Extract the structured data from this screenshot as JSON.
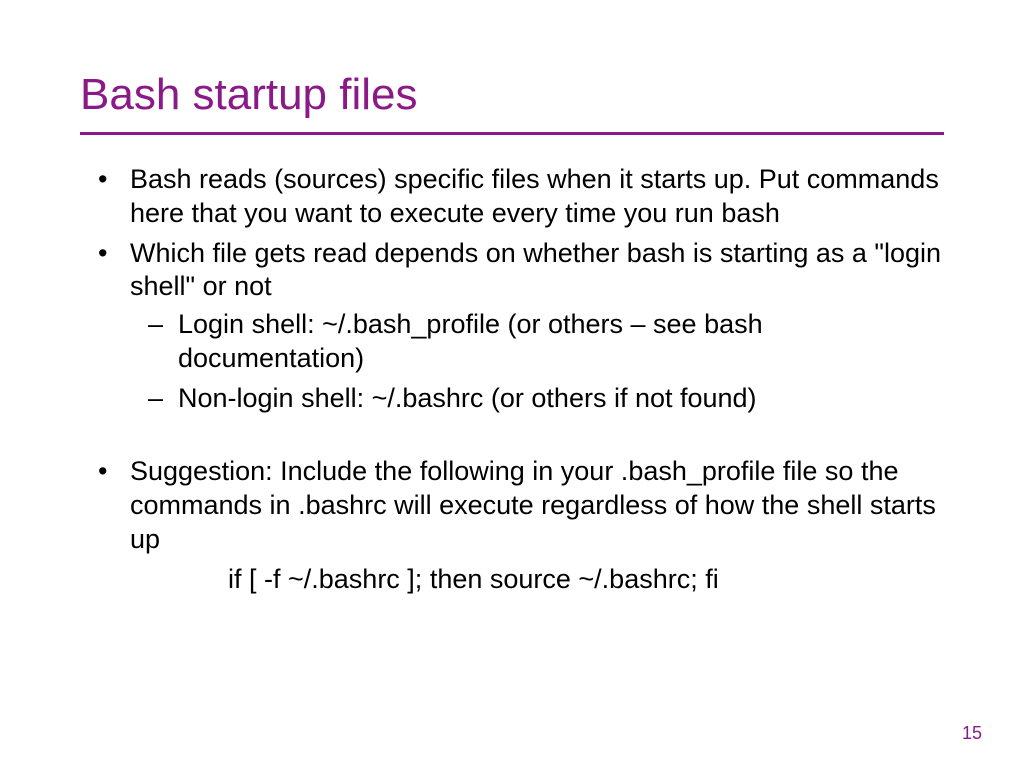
{
  "title": "Bash startup files",
  "bullets": {
    "b1": "Bash reads (sources) specific files when it starts up. Put commands here that you want to execute every time you run bash",
    "b2": "Which file gets read depends on whether bash is starting as a \"login shell\" or not",
    "b2_sub1": "Login shell: ~/.bash_profile (or others – see bash documentation)",
    "b2_sub2": "Non-login shell: ~/.bashrc (or others if not found)",
    "b3": "Suggestion: Include the following in your .bash_profile file so the commands in .bashrc will execute regardless of how the shell starts up",
    "code": "if [ -f ~/.bashrc ]; then source ~/.bashrc; fi"
  },
  "page_number": "15"
}
